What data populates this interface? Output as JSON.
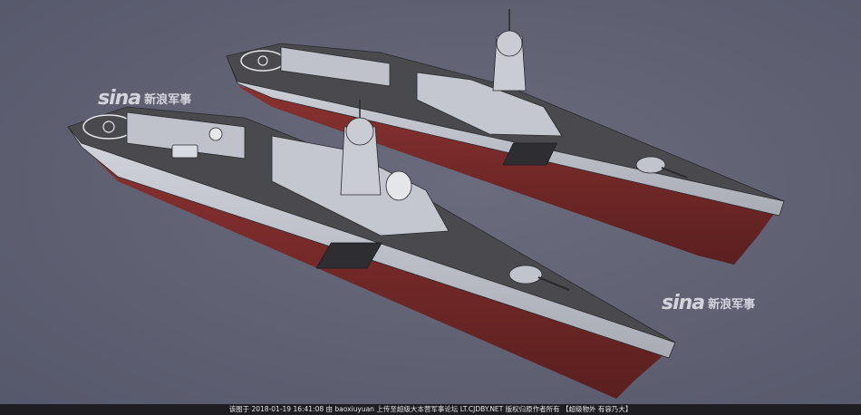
{
  "watermarks": [
    {
      "logo": "sina",
      "text": "新浪军事"
    },
    {
      "logo": "sina",
      "text": "新浪军事"
    }
  ],
  "caption": {
    "text": "该图于 2018-01-19 16:41:08 由 baoxiuyuan 上传至超级大本营军事论坛 LT.CJDBY.NET 版权归原作者所有 【超级物外 有容乃大】"
  },
  "colors": {
    "background": "#5f6173",
    "deck": "#4a4a4e",
    "hull_side": "#b9bcc4",
    "hull_red": "#7a2b2a",
    "superstructure": "#c4c7cf",
    "caption_bar": "#1e1e22"
  }
}
